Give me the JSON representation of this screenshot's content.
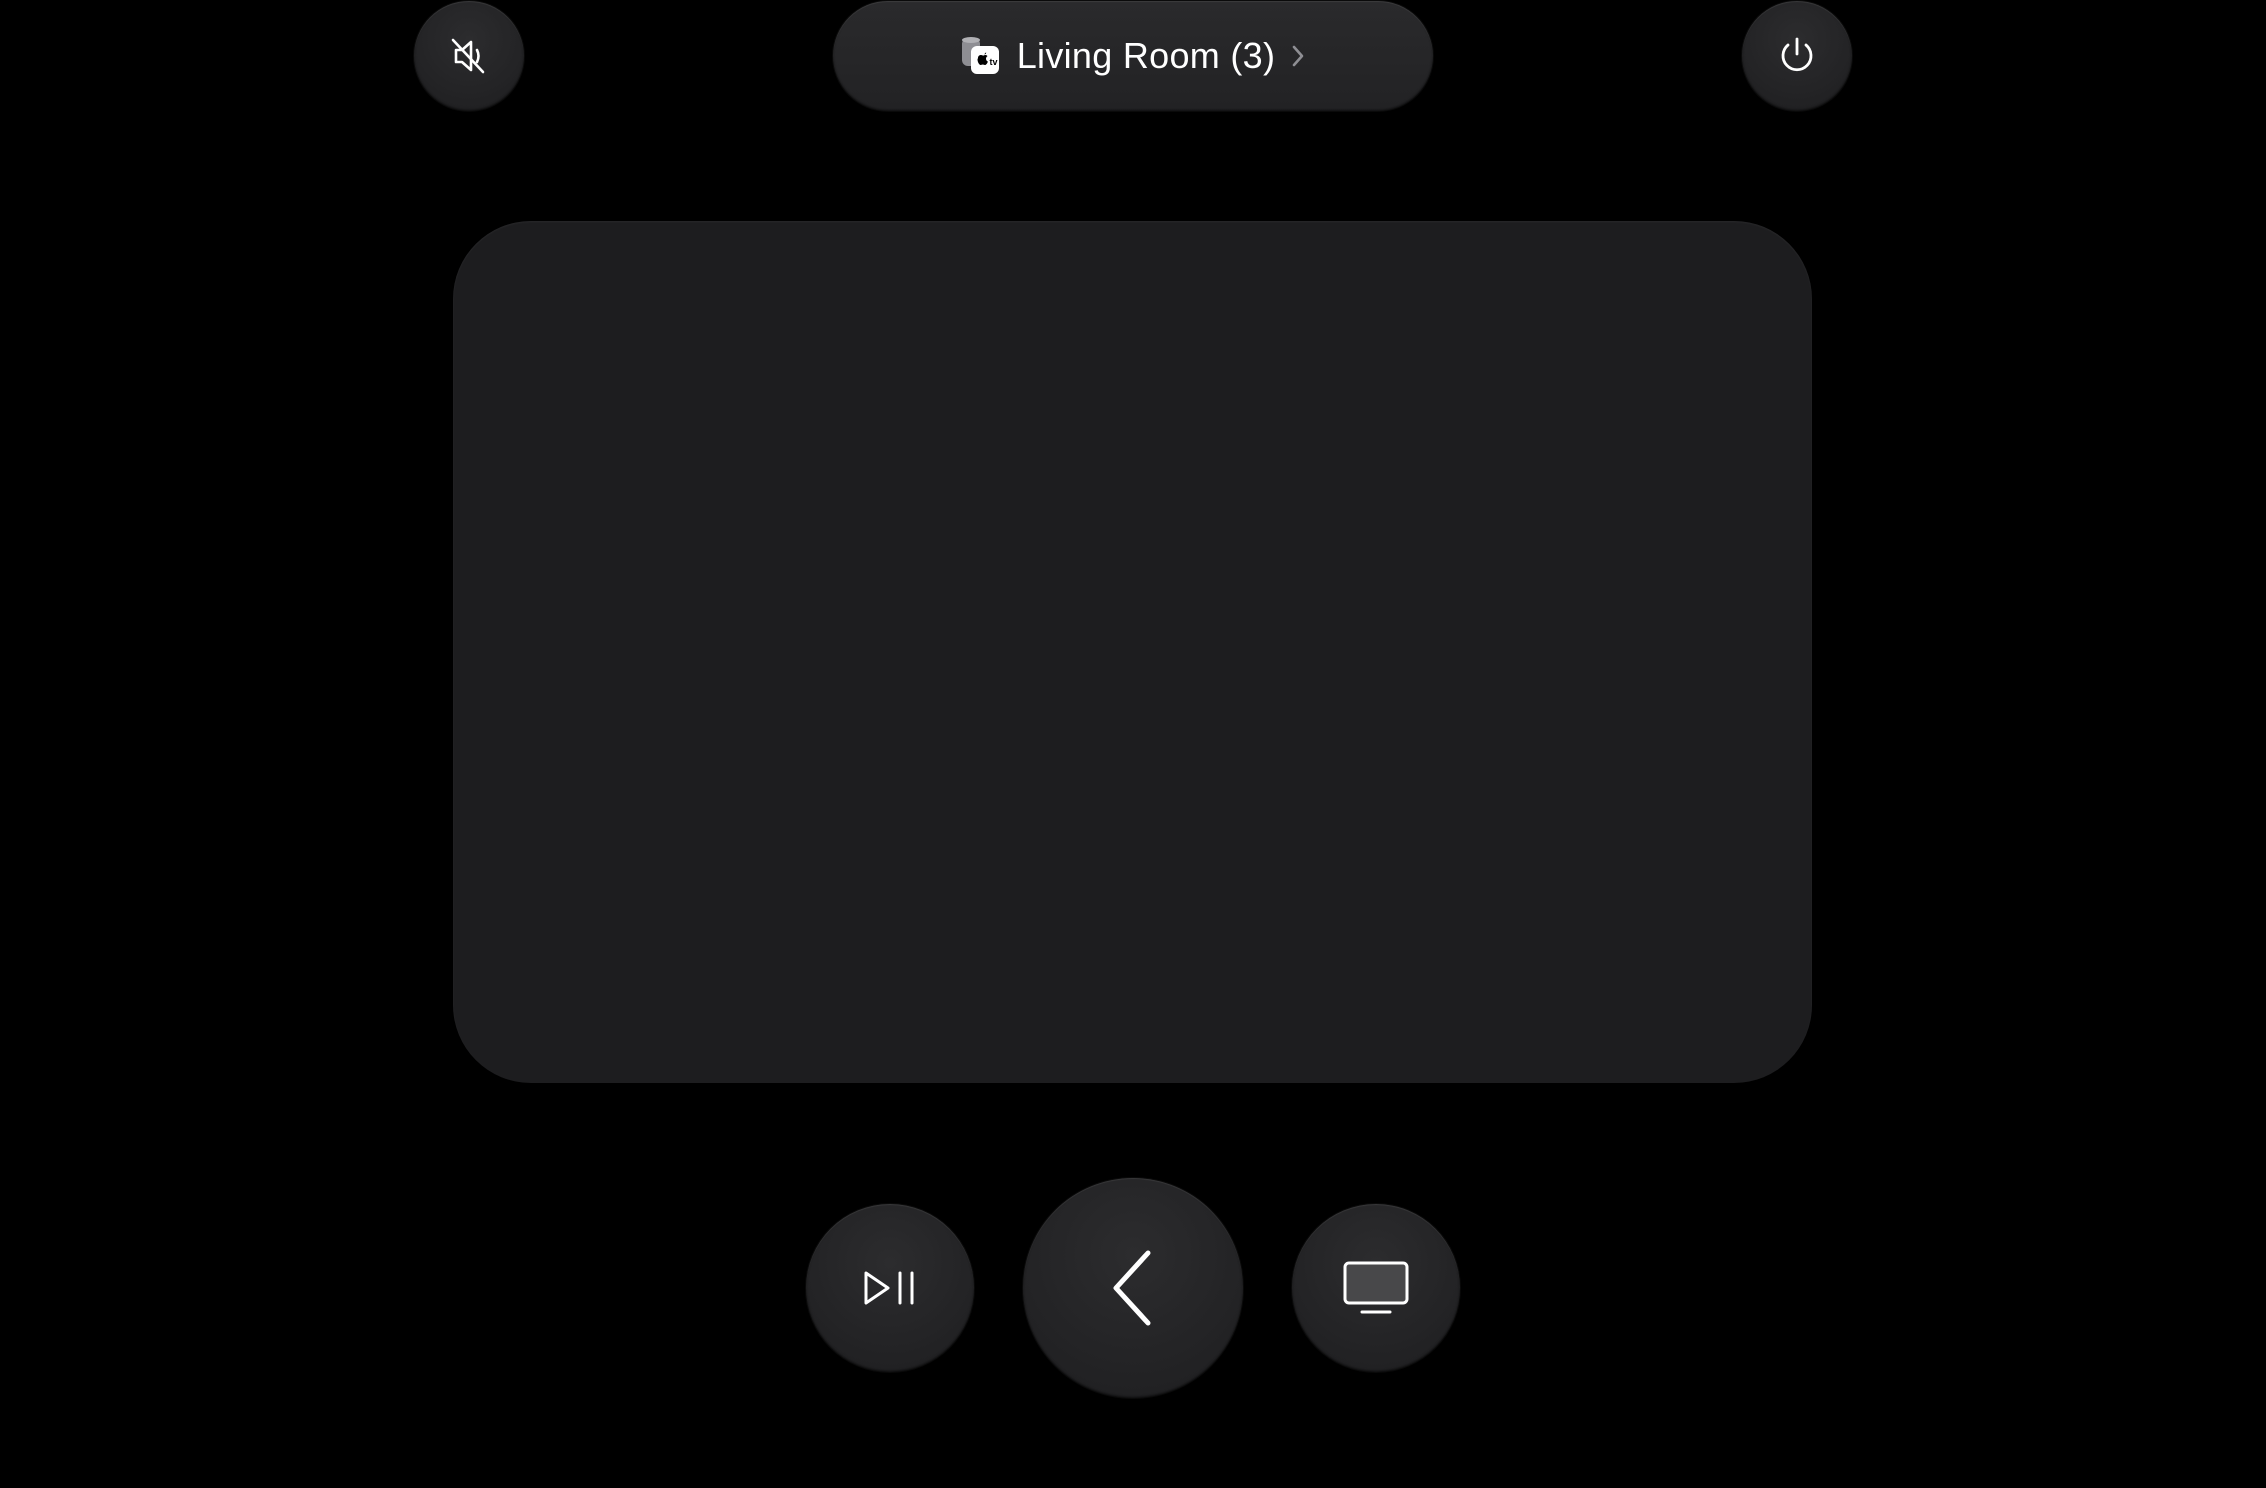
{
  "header": {
    "device_name": "Living Room (3)",
    "device_icon": "appletv-homepod-icon",
    "mute_icon": "speaker-slash-icon",
    "power_icon": "power-icon",
    "chevron_icon": "chevron-right-icon"
  },
  "touchpad": {
    "surface": "touch-surface"
  },
  "controls": {
    "play_pause_icon": "play-pause-icon",
    "back_icon": "chevron-left-icon",
    "tv_icon": "tv-icon"
  },
  "colors": {
    "background": "#000000",
    "button": "#222224",
    "touchpad": "#1d1d1f",
    "icon": "#ffffff"
  }
}
